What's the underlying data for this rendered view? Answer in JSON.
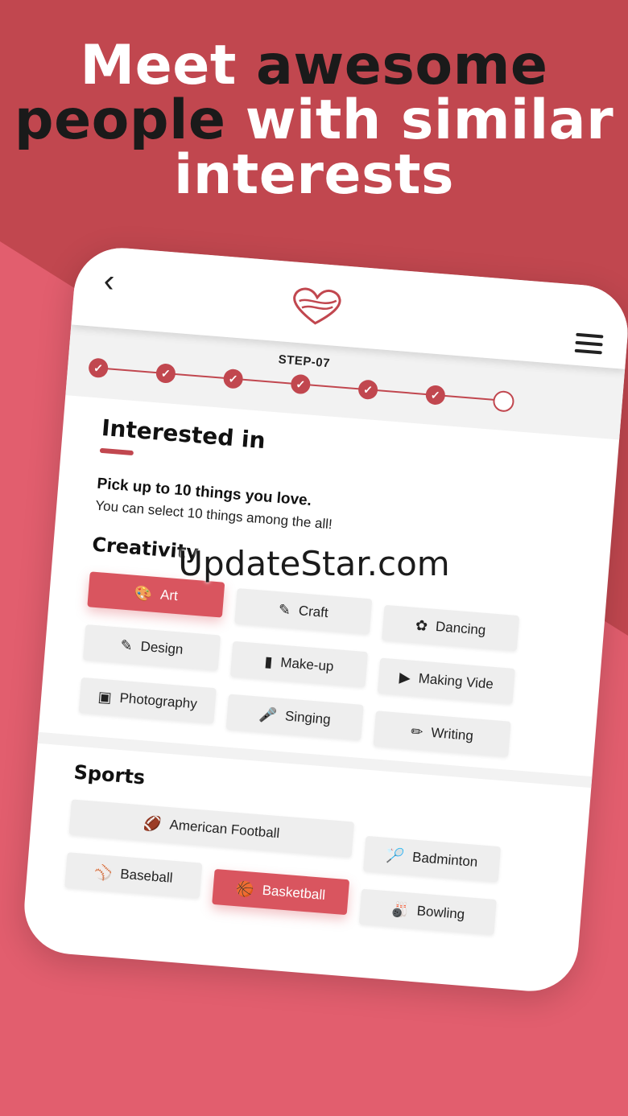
{
  "headline": {
    "line1_white": "Meet",
    "line1_dark": "awesome",
    "line2_dark": "people",
    "line2_white": "with similar",
    "line3_white": "interests"
  },
  "topbar": {
    "back_icon": "chevron-left-icon",
    "logo_icon": "heart-logo-icon",
    "menu_icon": "hamburger-menu-icon"
  },
  "progress": {
    "label": "STEP-07",
    "steps_done": 6,
    "steps_total": 7
  },
  "page": {
    "title": "Interested in",
    "pick_text": "Pick up to 10 things you love.",
    "sub_text": "You can select 10 things among the all!"
  },
  "creativity": {
    "title": "Creativity",
    "chips": [
      {
        "label": "Art",
        "icon": "palette-icon",
        "selected": true
      },
      {
        "label": "Craft",
        "icon": "pencil-icon",
        "selected": false
      },
      {
        "label": "Dancing",
        "icon": "dancer-icon",
        "selected": false
      },
      {
        "label": "Design",
        "icon": "pen-icon",
        "selected": false
      },
      {
        "label": "Make-up",
        "icon": "lipstick-icon",
        "selected": false
      },
      {
        "label": "Making Vide",
        "icon": "play-icon",
        "selected": false
      },
      {
        "label": "Photography",
        "icon": "camera-icon",
        "selected": false
      },
      {
        "label": "Singing",
        "icon": "microphone-icon",
        "selected": false
      },
      {
        "label": "Writing",
        "icon": "writing-icon",
        "selected": false
      }
    ]
  },
  "sports": {
    "title": "Sports",
    "chips": [
      {
        "label": "American Football",
        "icon": "football-icon",
        "selected": false
      },
      {
        "label": "Badminton",
        "icon": "badminton-icon",
        "selected": false
      },
      {
        "label": "Baseball",
        "icon": "baseball-icon",
        "selected": false
      },
      {
        "label": "Basketball",
        "icon": "basketball-icon",
        "selected": true
      },
      {
        "label": "Bowling",
        "icon": "bowling-icon",
        "selected": false
      }
    ]
  },
  "watermark": "UpdateStar.com",
  "colors": {
    "accent": "#d9555f",
    "background_top": "#c1474f",
    "background_bottom": "#e25e6e"
  }
}
